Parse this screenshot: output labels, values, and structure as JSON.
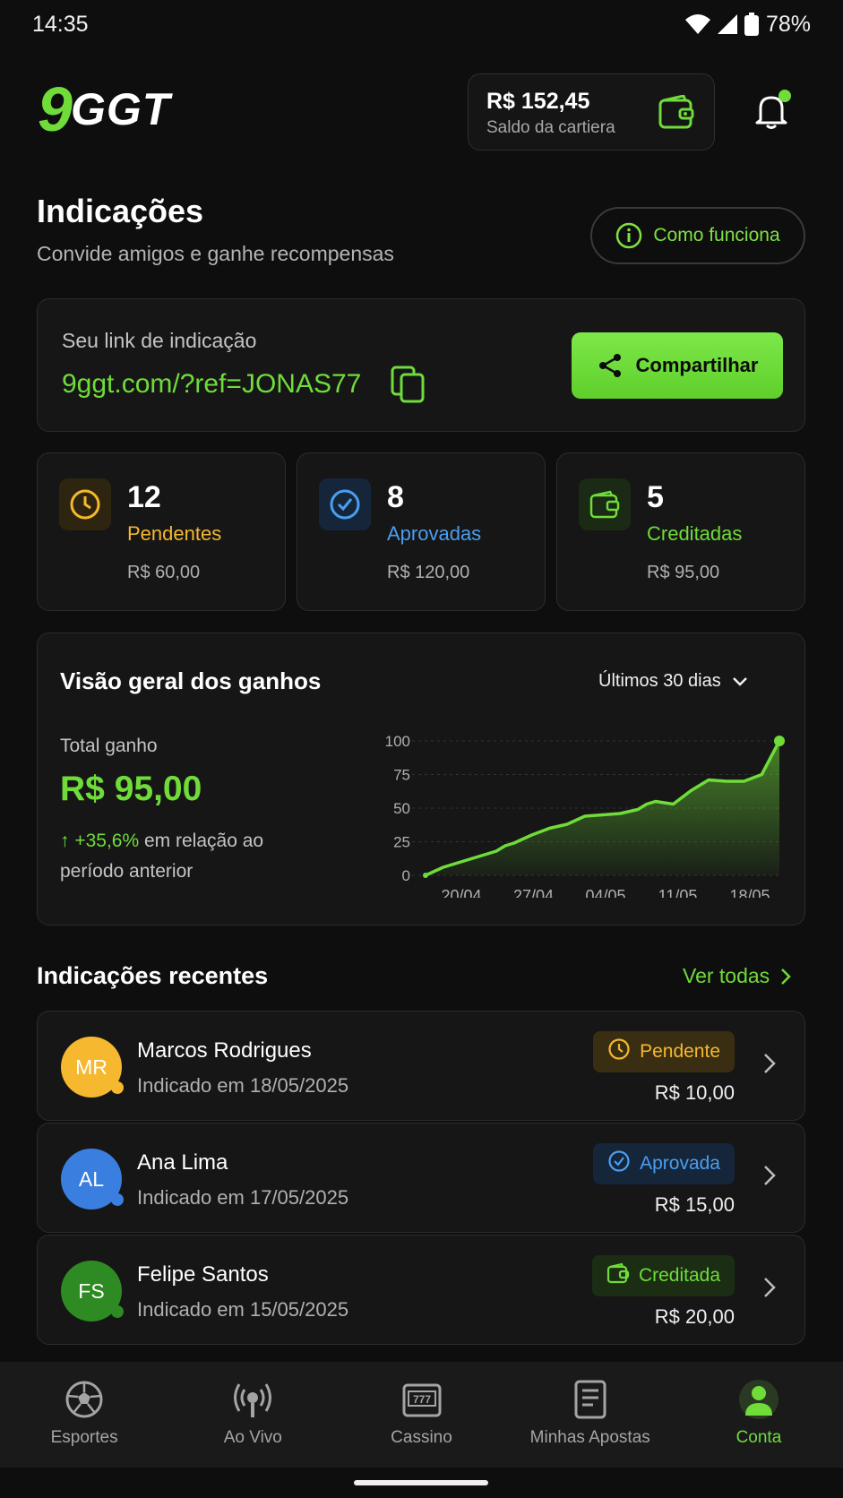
{
  "status_bar": {
    "time": "14:35",
    "battery": "78%"
  },
  "header": {
    "logo_mark": "9",
    "logo_text": "GGT",
    "wallet_amount": "R$ 152,45",
    "wallet_label": "Saldo da cartiera"
  },
  "page": {
    "title": "Indicações",
    "subtitle": "Convide amigos e ganhe recompensas",
    "how_button": "Como funciona"
  },
  "referral_link": {
    "label": "Seu link de indicação",
    "url": "9ggt.com/?ref=JONAS77",
    "share_button": "Compartilhar"
  },
  "stats": [
    {
      "count": "12",
      "label": "Pendentes",
      "value": "R$ 60,00",
      "color": "#f5b82e",
      "icon": "clock-icon"
    },
    {
      "count": "8",
      "label": "Aprovadas",
      "value": "R$ 120,00",
      "color": "#4a9ef0",
      "icon": "check-circle-icon"
    },
    {
      "count": "5",
      "label": "Creditadas",
      "value": "R$ 95,00",
      "color": "#6fdc3a",
      "icon": "wallet-icon"
    }
  ],
  "earnings": {
    "title": "Visão geral dos ganhos",
    "range": "Últimos 30 dias",
    "total_label": "Total ganho",
    "total_value": "R$ 95,00",
    "delta": "+35,6%",
    "delta_text": "em relação ao período anterior"
  },
  "chart_data": {
    "type": "area",
    "x_ticks": [
      "20/04",
      "27/04",
      "04/05",
      "11/05",
      "18/05"
    ],
    "y_ticks": [
      "100",
      "75",
      "50",
      "25",
      "0"
    ],
    "ylim": [
      0,
      100
    ],
    "grid": true,
    "color": "#6fdc3a",
    "x": [
      0,
      2,
      4,
      6,
      8,
      9,
      10,
      12,
      14,
      16,
      18,
      20,
      22,
      24,
      25,
      26,
      28,
      30,
      32,
      34,
      36,
      38,
      40
    ],
    "values": [
      0,
      6,
      10,
      14,
      18,
      22,
      24,
      30,
      35,
      38,
      44,
      45,
      46,
      49,
      53,
      55,
      53,
      63,
      71,
      70,
      70,
      75,
      100
    ]
  },
  "recent": {
    "title": "Indicações recentes",
    "see_all": "Ver todas",
    "items": [
      {
        "initials": "MR",
        "name": "Marcos Rodrigues",
        "date": "Indicado em 18/05/2025",
        "status": "Pendente",
        "amount": "R$ 10,00",
        "avatar_color": "#f5b82e",
        "status_color": "#f5b82e",
        "status_bg": "#3a2e12",
        "icon": "clock-icon"
      },
      {
        "initials": "AL",
        "name": "Ana Lima",
        "date": "Indicado em 17/05/2025",
        "status": "Aprovada",
        "amount": "R$ 15,00",
        "avatar_color": "#3a7ee0",
        "status_color": "#4a9ef0",
        "status_bg": "#15253a",
        "icon": "check-circle-icon"
      },
      {
        "initials": "FS",
        "name": "Felipe Santos",
        "date": "Indicado em 15/05/2025",
        "status": "Creditada",
        "amount": "R$ 20,00",
        "avatar_color": "#2e8a22",
        "status_color": "#6fdc3a",
        "status_bg": "#1b2e14",
        "icon": "wallet-icon"
      }
    ]
  },
  "bottom_nav": [
    {
      "label": "Esportes",
      "icon": "soccer-ball-icon"
    },
    {
      "label": "Ao Vivo",
      "icon": "broadcast-icon"
    },
    {
      "label": "Cassino",
      "icon": "slot-machine-icon"
    },
    {
      "label": "Minhas Apostas",
      "icon": "betslip-icon"
    },
    {
      "label": "Conta",
      "icon": "user-icon",
      "active": true
    }
  ]
}
